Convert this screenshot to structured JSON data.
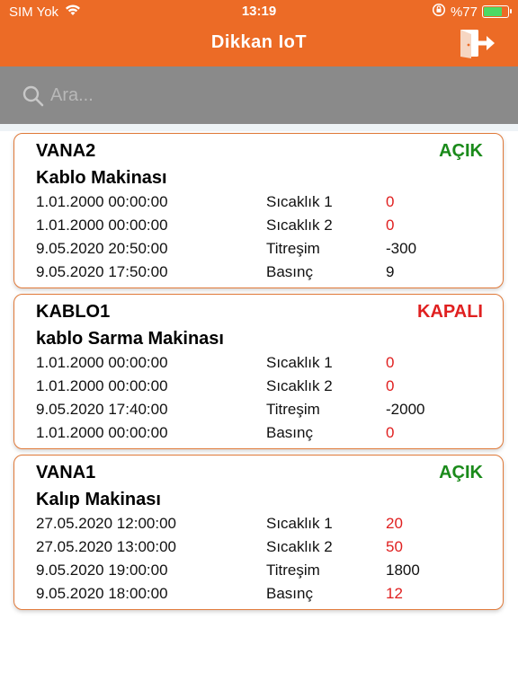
{
  "status_bar": {
    "carrier": "SIM Yok",
    "time": "13:19",
    "battery": "%77",
    "battery_level": 0.77
  },
  "header": {
    "title": "Dikkan IoT"
  },
  "search": {
    "placeholder": "Ara..."
  },
  "colors": {
    "header": "#ec6b26",
    "search_bg": "#8a8a8a",
    "on": "#1a8a1a",
    "off": "#e02020",
    "card_border": "#e07a3a"
  },
  "devices": [
    {
      "name": "VANA2",
      "state": "AÇIK",
      "machine": "Kablo Makinası",
      "rows": [
        {
          "date": "1.01.2000 00:00:00",
          "label": "Sıcaklık 1",
          "value": "0"
        },
        {
          "date": "1.01.2000 00:00:00",
          "label": "Sıcaklık 2",
          "value": "0"
        },
        {
          "date": "9.05.2020 20:50:00",
          "label": "Titreşim",
          "value": "-300"
        },
        {
          "date": "9.05.2020 17:50:00",
          "label": "Basınç",
          "value": "9"
        }
      ]
    },
    {
      "name": "KABLO1",
      "state": "KAPALI",
      "machine": "kablo Sarma Makinası",
      "rows": [
        {
          "date": "1.01.2000 00:00:00",
          "label": "Sıcaklık 1",
          "value": "0"
        },
        {
          "date": "1.01.2000 00:00:00",
          "label": "Sıcaklık 2",
          "value": "0"
        },
        {
          "date": "9.05.2020 17:40:00",
          "label": "Titreşim",
          "value": "-2000"
        },
        {
          "date": "1.01.2000 00:00:00",
          "label": "Basınç",
          "value": "0"
        }
      ]
    },
    {
      "name": "VANA1",
      "state": "AÇIK",
      "machine": "Kalıp Makinası",
      "rows": [
        {
          "date": "27.05.2020 12:00:00",
          "label": "Sıcaklık 1",
          "value": "20"
        },
        {
          "date": "27.05.2020 13:00:00",
          "label": "Sıcaklık 2",
          "value": "50"
        },
        {
          "date": "9.05.2020 19:00:00",
          "label": "Titreşim",
          "value": "1800"
        },
        {
          "date": "9.05.2020 18:00:00",
          "label": "Basınç",
          "value": "12"
        }
      ]
    }
  ]
}
